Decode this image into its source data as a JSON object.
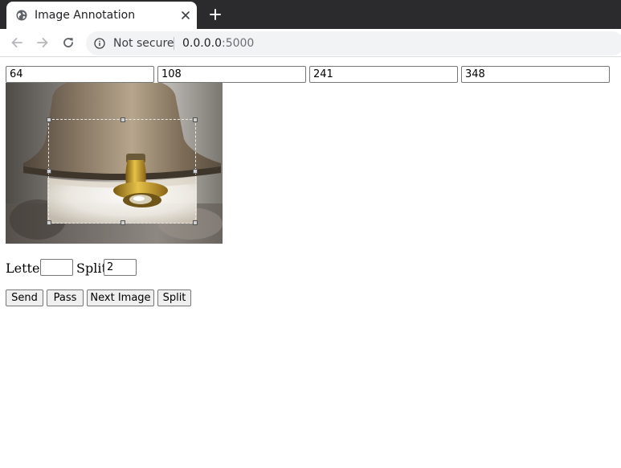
{
  "browser": {
    "tab": {
      "title": "Image Annotation",
      "favicon_icon": "globe-icon",
      "close_icon": "close-icon"
    },
    "new_tab_icon": "plus-icon",
    "toolbar": {
      "back_icon": "arrow-left-icon",
      "forward_icon": "arrow-right-icon",
      "reload_icon": "reload-icon",
      "security_icon": "info-icon",
      "security_text": "Not secure",
      "url_host": "0.0.0.0",
      "url_port": ":5000"
    }
  },
  "annotation": {
    "inputs": [
      {
        "value": "64"
      },
      {
        "value": "108"
      },
      {
        "value": "241"
      },
      {
        "value": "348"
      }
    ],
    "image_subject": "brass bell with clapper"
  },
  "form": {
    "letter_label": "Letter:",
    "letter_value": "",
    "split_label": "Split:",
    "split_value": "2"
  },
  "buttons": {
    "send": "Send",
    "pass": "Pass",
    "next_image": "Next Image",
    "split": "Split"
  },
  "colors": {
    "tabbar": "#2b2b2d",
    "omnibox": "#f1f3f4",
    "button_bg": "#efefef"
  }
}
